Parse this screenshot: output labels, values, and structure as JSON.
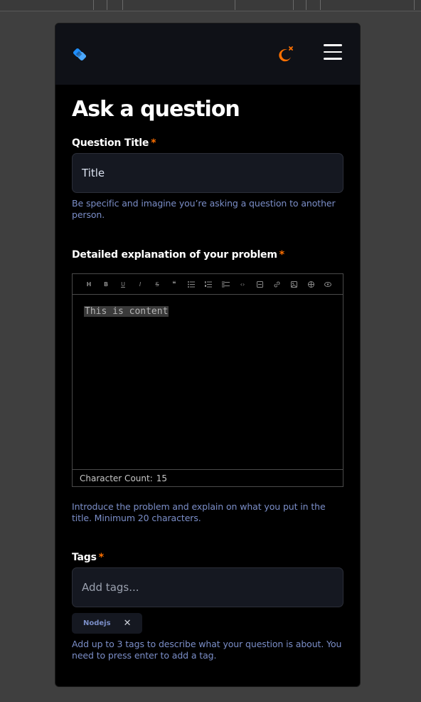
{
  "header": {
    "logo_icon": "stack-logo-icon",
    "theme_icon": "moon-sun-icon",
    "menu_icon": "hamburger-menu-icon",
    "accent_color": "#ff7000",
    "logo_color": "#1f8fff"
  },
  "page": {
    "title": "Ask a question"
  },
  "question_title": {
    "label": "Question Title",
    "required_mark": "*",
    "value": "Title",
    "hint": "Be specific and imagine you’re asking a question to another person."
  },
  "explanation": {
    "label": "Detailed explanation of your problem",
    "required_mark": "*",
    "toolbar": [
      "H",
      "B",
      "U",
      "I",
      "S",
      "❝",
      "list",
      "ordered-list",
      "checklist",
      "code",
      "code-block",
      "link",
      "image",
      "table",
      "preview"
    ],
    "content": "This is content",
    "character_count_label": "Character Count:",
    "character_count": "15",
    "hint": "Introduce the problem and explain on what you put in the title. Minimum 20 characters."
  },
  "tags": {
    "label": "Tags",
    "required_mark": "*",
    "placeholder": "Add tags...",
    "items": [
      {
        "label": "Nodejs"
      }
    ],
    "remove_symbol": "✕",
    "hint": "Add up to 3 tags to describe what your question is about. You need to press enter to add a tag."
  }
}
